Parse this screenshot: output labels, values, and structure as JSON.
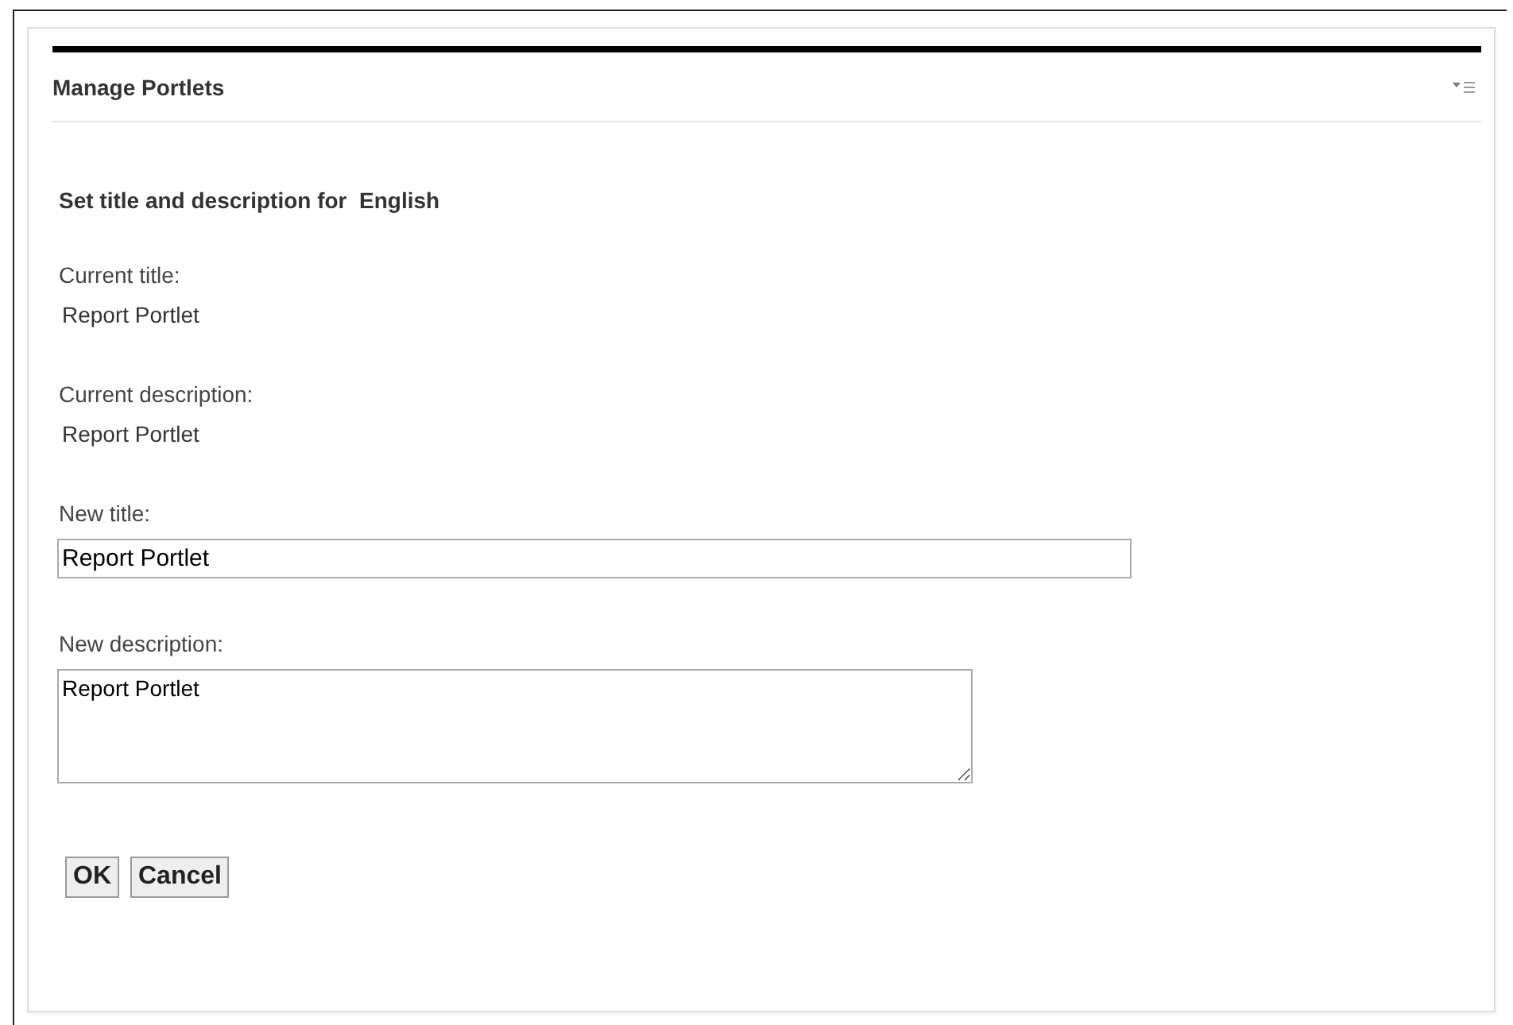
{
  "portlet": {
    "title": "Manage Portlets"
  },
  "heading": {
    "text": "Set title and description for",
    "language": "English"
  },
  "current": [
    {
      "label": "Current title:",
      "value": "Report Portlet"
    },
    {
      "label": "Current description:",
      "value": "Report Portlet"
    }
  ],
  "fields": [
    {
      "label": "New title:",
      "value": "Report Portlet",
      "kind": "input"
    },
    {
      "label": "New description:",
      "value": "Report Portlet",
      "kind": "textarea"
    }
  ],
  "buttons": [
    "OK",
    "Cancel"
  ]
}
